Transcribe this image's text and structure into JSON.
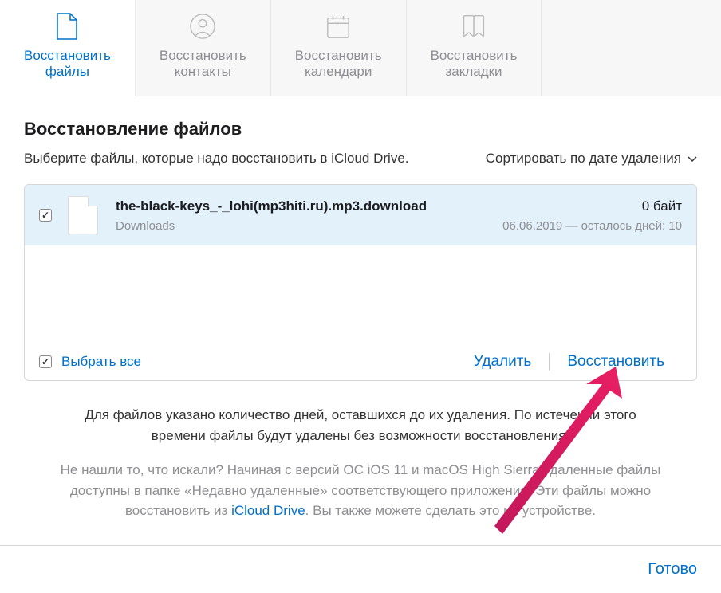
{
  "tabs": [
    {
      "label": "Восстановить\nфайлы"
    },
    {
      "label": "Восстановить\nконтакты"
    },
    {
      "label": "Восстановить\nкалендари"
    },
    {
      "label": "Восстановить\nзакладки"
    }
  ],
  "heading": "Восстановление файлов",
  "subtext": "Выберите файлы, которые надо восстановить в iCloud Drive.",
  "sort_label": "Сортировать по дате удаления",
  "file": {
    "name": "the-black-keys_-_lohi(mp3hiti.ru).mp3.download",
    "folder": "Downloads",
    "size": "0 байт",
    "date_remaining": "06.06.2019 — осталось дней: 10"
  },
  "select_all_label": "Выбрать все",
  "delete_label": "Удалить",
  "restore_label": "Восстановить",
  "footer_text1": "Для файлов указано количество дней, оставшихся до их удаления. По истечении этого времени файлы будут удалены без возможности восстановления.",
  "footer_text2_a": "Не нашли то, что искали? Начиная с версий ОС iOS 11 и macOS High Sierra удаленные файлы доступны в папке «Недавно удаленные» соответствующего приложения. Эти файлы можно восстановить из ",
  "footer_text2_link": "iCloud Drive",
  "footer_text2_b": ". Вы также можете сделать это на устройстве.",
  "done_label": "Готово"
}
